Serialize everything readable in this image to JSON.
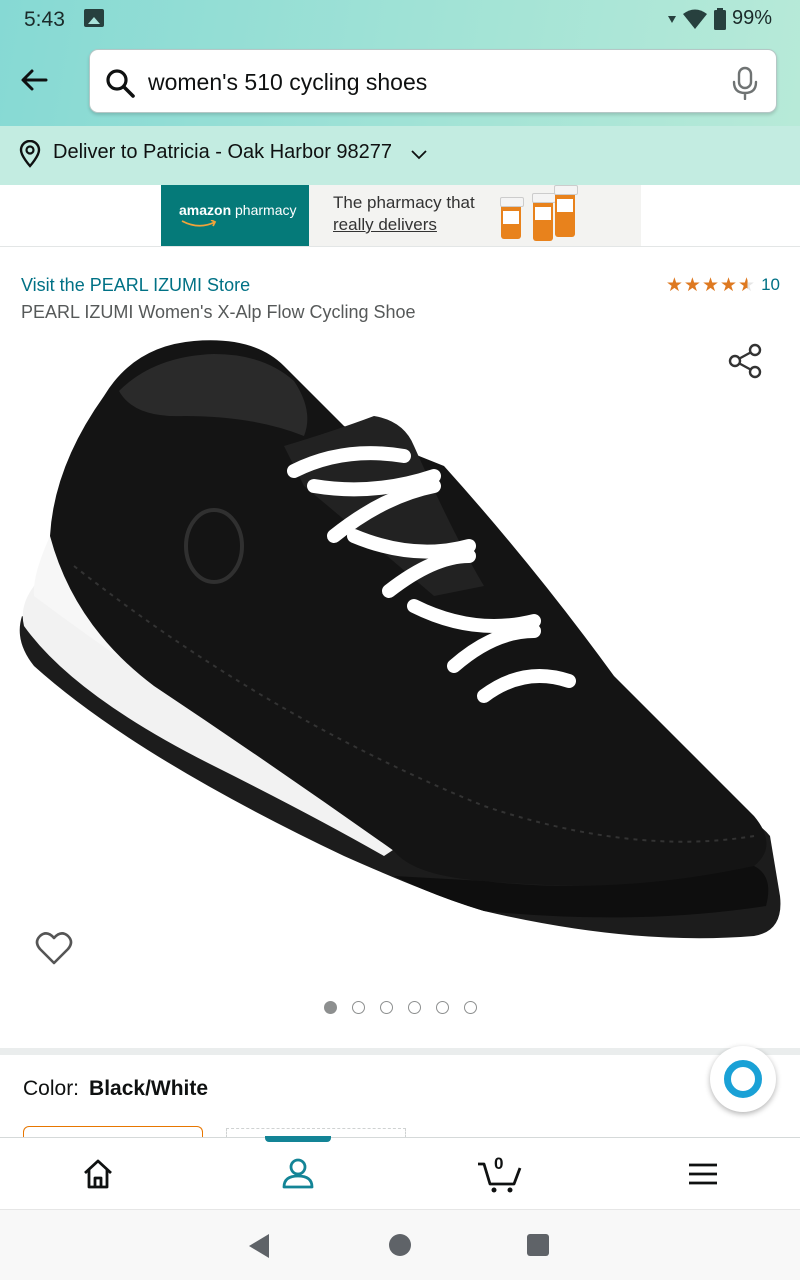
{
  "status_bar": {
    "time": "5:43",
    "battery": "99%"
  },
  "search": {
    "query": "women's 510 cycling shoes"
  },
  "delivery": {
    "text": "Deliver to Patricia - Oak Harbor 98277"
  },
  "ad": {
    "brand": "amazon",
    "brand_sub": "pharmacy",
    "line1": "The pharmacy that",
    "line2": "really delivers"
  },
  "product": {
    "store_link": "Visit the PEARL IZUMI Store",
    "title": "PEARL IZUMI Women's X-Alp Flow Cycling Shoe",
    "rating": 4.5,
    "review_count": "10",
    "image_count": 6,
    "active_image": 1
  },
  "color": {
    "label": "Color:",
    "value": "Black/White"
  },
  "cart": {
    "count": "0"
  },
  "colors": {
    "link": "#007185",
    "star": "#de7921",
    "accent": "#138496",
    "alexa": "#1aa1d6"
  }
}
